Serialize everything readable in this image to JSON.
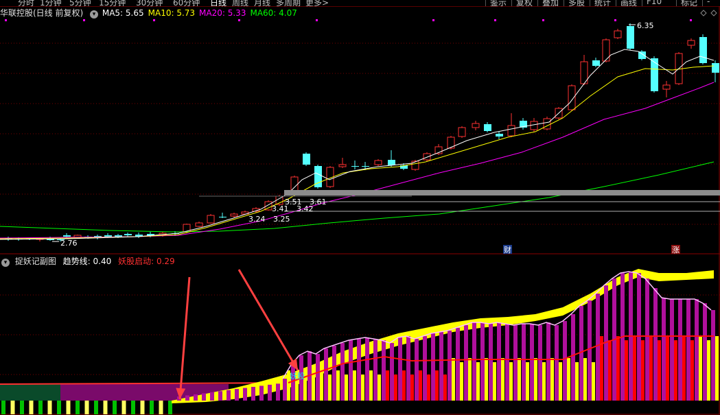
{
  "toolbar": {
    "periods": [
      "分时",
      "1分钟",
      "5分钟",
      "15分钟",
      "30分钟",
      "60分钟",
      "日线",
      "周线",
      "月线",
      "多周期",
      "更多>"
    ],
    "active_period": "日线",
    "actions": [
      "鉴示",
      "复权",
      "叠加",
      "多股",
      "统计",
      "画线",
      "F10",
      "标记",
      "-"
    ]
  },
  "main_panel": {
    "title": "华联控股(日线 前复权)",
    "ma_labels": [
      {
        "name": "MA5: ",
        "value": "5.65",
        "color": "#ffffff"
      },
      {
        "name": "MA10: ",
        "value": "5.73",
        "color": "#ffff00"
      },
      {
        "name": "MA20: ",
        "value": "5.33",
        "color": "#ff00ff"
      },
      {
        "name": "MA60: ",
        "value": "4.07",
        "color": "#00ff00"
      }
    ],
    "annotations": {
      "high": "6.35",
      "low": "2.76",
      "price_a": "3.51",
      "price_b": "3.61",
      "price_c": "3.41",
      "price_d": "3.42",
      "price_e": "3.24",
      "price_f": "3.25",
      "finance_tag": "财",
      "limit_tag": "涨"
    }
  },
  "sub_panel": {
    "title": "捉妖记副图",
    "trend_label": "趋势线: ",
    "trend_value": "0.40",
    "signal_label": "妖股启动: ",
    "signal_value": "0.29",
    "marker_text": "妖股"
  },
  "colors": {
    "up": "#ff3232",
    "down": "#54ffff",
    "ma5": "#ffffff",
    "ma10": "#ffff00",
    "ma20": "#ff00ff",
    "ma60": "#00ff00",
    "bar_magenta": "#b0109c",
    "bar_yellow": "#ffff00",
    "bar_red": "#ff0000",
    "arrow": "#ff4040"
  }
}
